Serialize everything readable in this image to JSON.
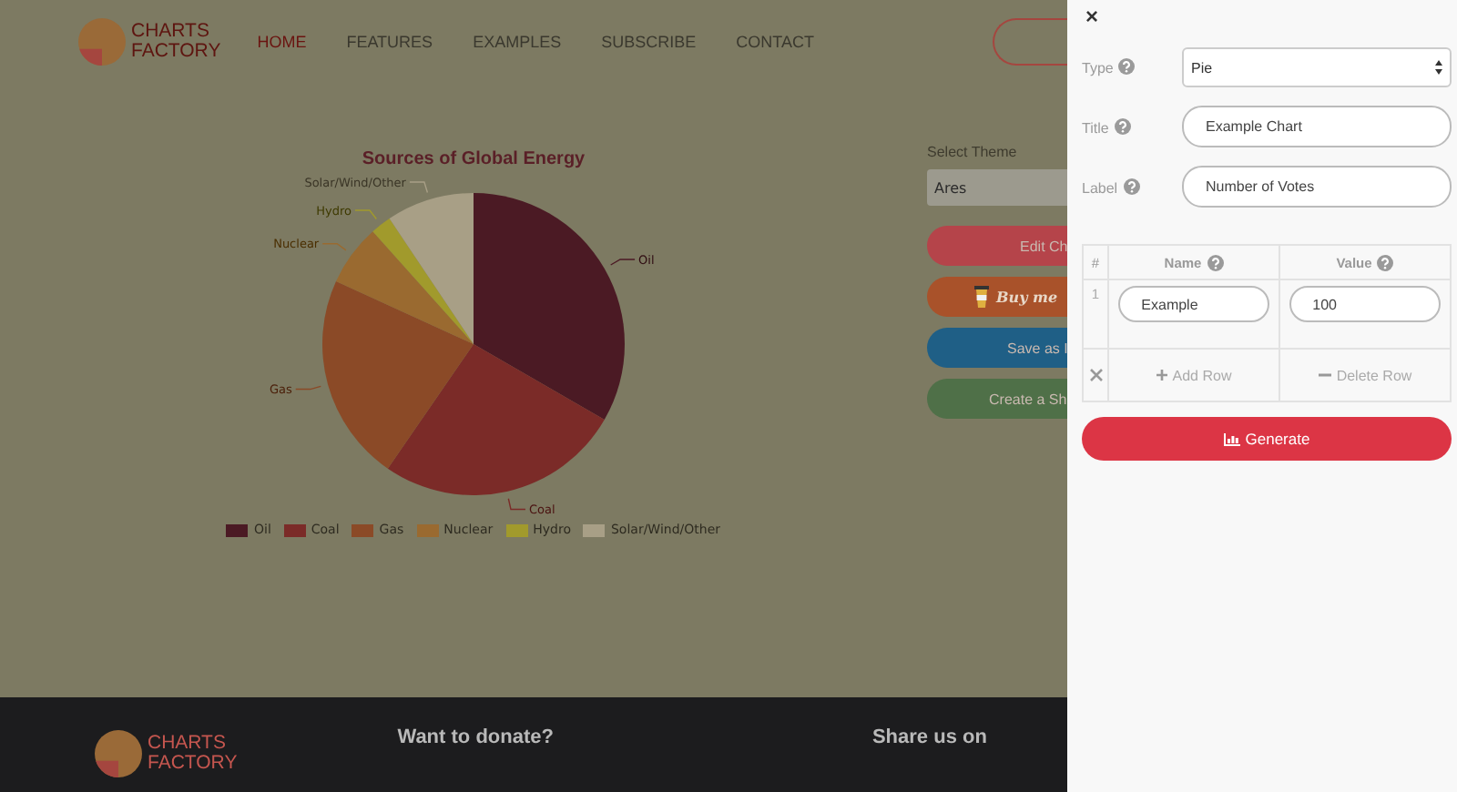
{
  "nav": {
    "logo": [
      "CHARTS",
      "FACTORY"
    ],
    "links": [
      {
        "label": "HOME",
        "selected": true
      },
      {
        "label": "FEATURES",
        "selected": false
      },
      {
        "label": "EXAMPLES",
        "selected": false
      },
      {
        "label": "SUBSCRIBE",
        "selected": false
      },
      {
        "label": "CONTACT",
        "selected": false
      }
    ]
  },
  "chart": {
    "chart_data": {
      "type": "pie",
      "title": "Sources of Global Energy",
      "categories": [
        "Oil",
        "Coal",
        "Gas",
        "Nuclear",
        "Hydro",
        "Solar/Wind/Other"
      ],
      "values": [
        33,
        26,
        22,
        6.5,
        2.2,
        9.3
      ]
    }
  },
  "theme": {
    "label": "Select Theme",
    "value": "Ares"
  },
  "actions": [
    {
      "kind": "edit",
      "label": "Edit Ch"
    },
    {
      "kind": "coffee",
      "label": "Buy me"
    },
    {
      "kind": "save",
      "label": "Save as I"
    },
    {
      "kind": "share",
      "label": "Create a Sh"
    }
  ],
  "footer": {
    "logo": [
      "CHARTS",
      "FACTORY"
    ],
    "headings": [
      "Want to donate?",
      "Share us on"
    ]
  },
  "panel": {
    "close": "×",
    "fields": [
      {
        "kind": "select",
        "label": "Type",
        "value": "Pie"
      },
      {
        "kind": "text",
        "label": "Title",
        "value": "Example Chart"
      },
      {
        "kind": "text",
        "label": "Label",
        "value": "Number of Votes"
      }
    ],
    "table": {
      "columns": [
        "#",
        "Name",
        "Value"
      ],
      "rows": [
        {
          "index": "1",
          "name": "Example",
          "value": "100"
        }
      ],
      "add": "Add Row",
      "delete": "Delete Row"
    },
    "generate": "Generate"
  }
}
